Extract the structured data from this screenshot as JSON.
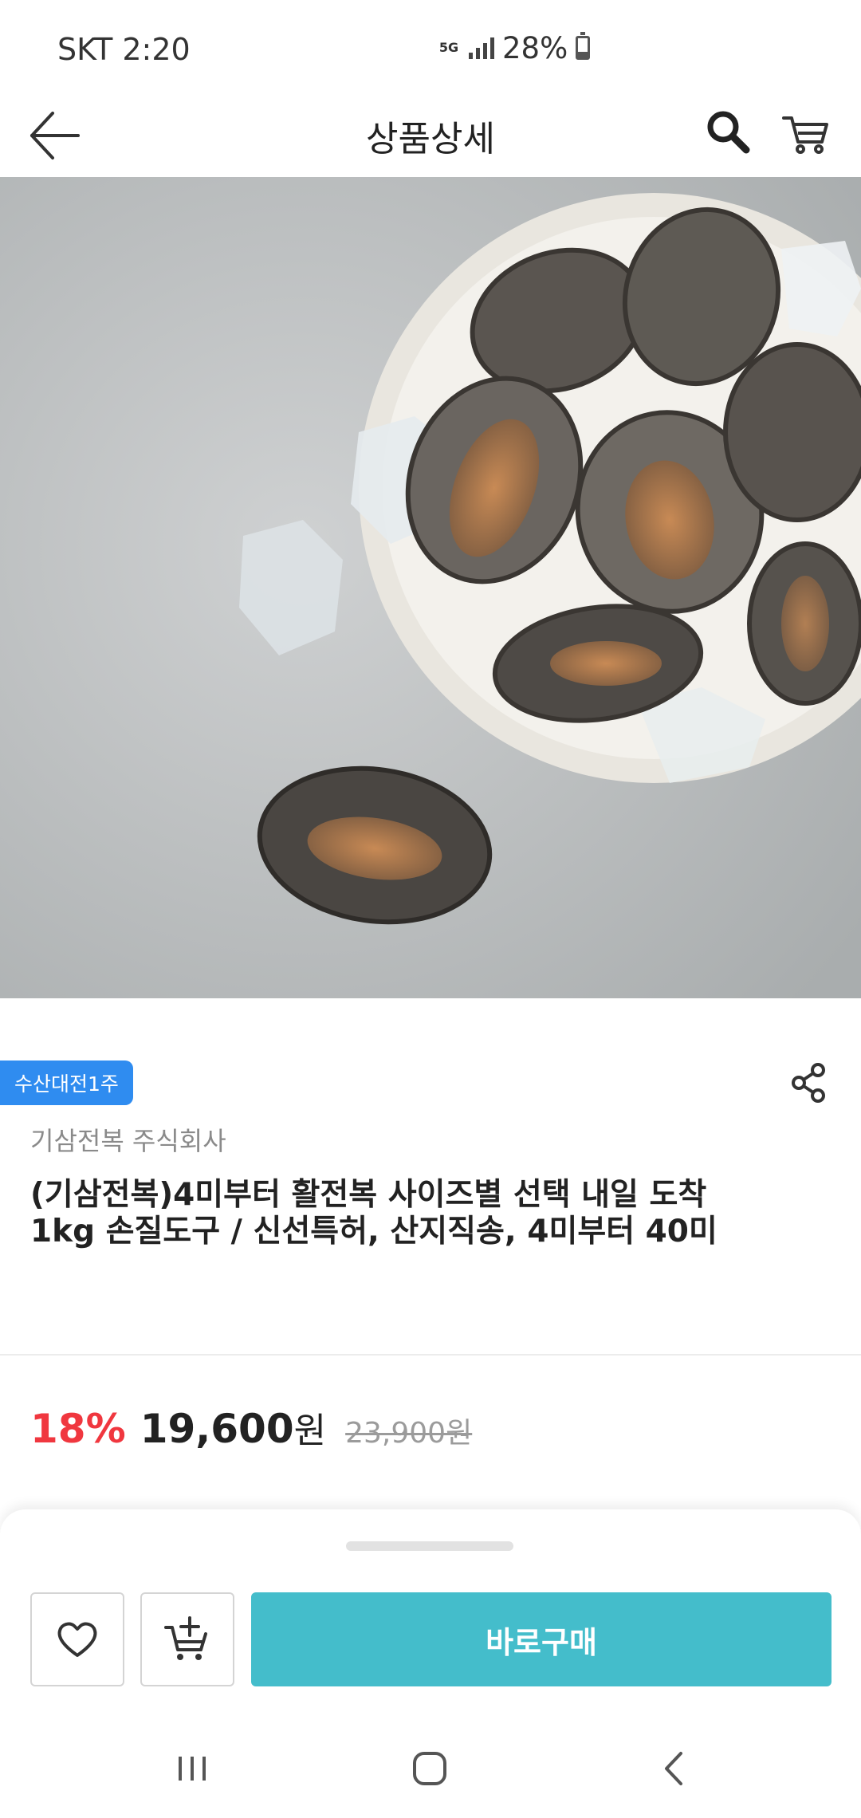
{
  "status_bar": {
    "carrier_time": "SKT 2:20",
    "network": "5G",
    "battery": "28%",
    "battery_level": 0.28
  },
  "header": {
    "title": "상품상세",
    "back_icon": "arrow-left-icon",
    "search_icon": "search-icon",
    "cart_icon": "cart-icon"
  },
  "gallery": {
    "image_alt": "abalone-on-plate-photo",
    "current_page": 1
  },
  "product": {
    "badge": "수산대전1주",
    "seller": "기삼전복 주식회사",
    "title": "(기삼전복)4미부터 활전복 사이즈별 선택 내일 도착 1kg 손질도구 / 신선특허, 산지직송, 4미부터 40미",
    "discount_rate": "18%",
    "sale_price": "19,600",
    "sale_unit": "원",
    "original_price": "23,900원"
  },
  "actions": {
    "wish_icon": "heart-icon",
    "add_cart_icon": "cart-add-icon",
    "buy_now": "바로구매"
  },
  "colors": {
    "accent": "#44bdcb",
    "badge": "#2f8cf0",
    "discount": "#f0373f"
  },
  "nav": {
    "recent_icon": "recent-apps-icon",
    "home_icon": "home-icon",
    "back_icon": "back-icon"
  }
}
